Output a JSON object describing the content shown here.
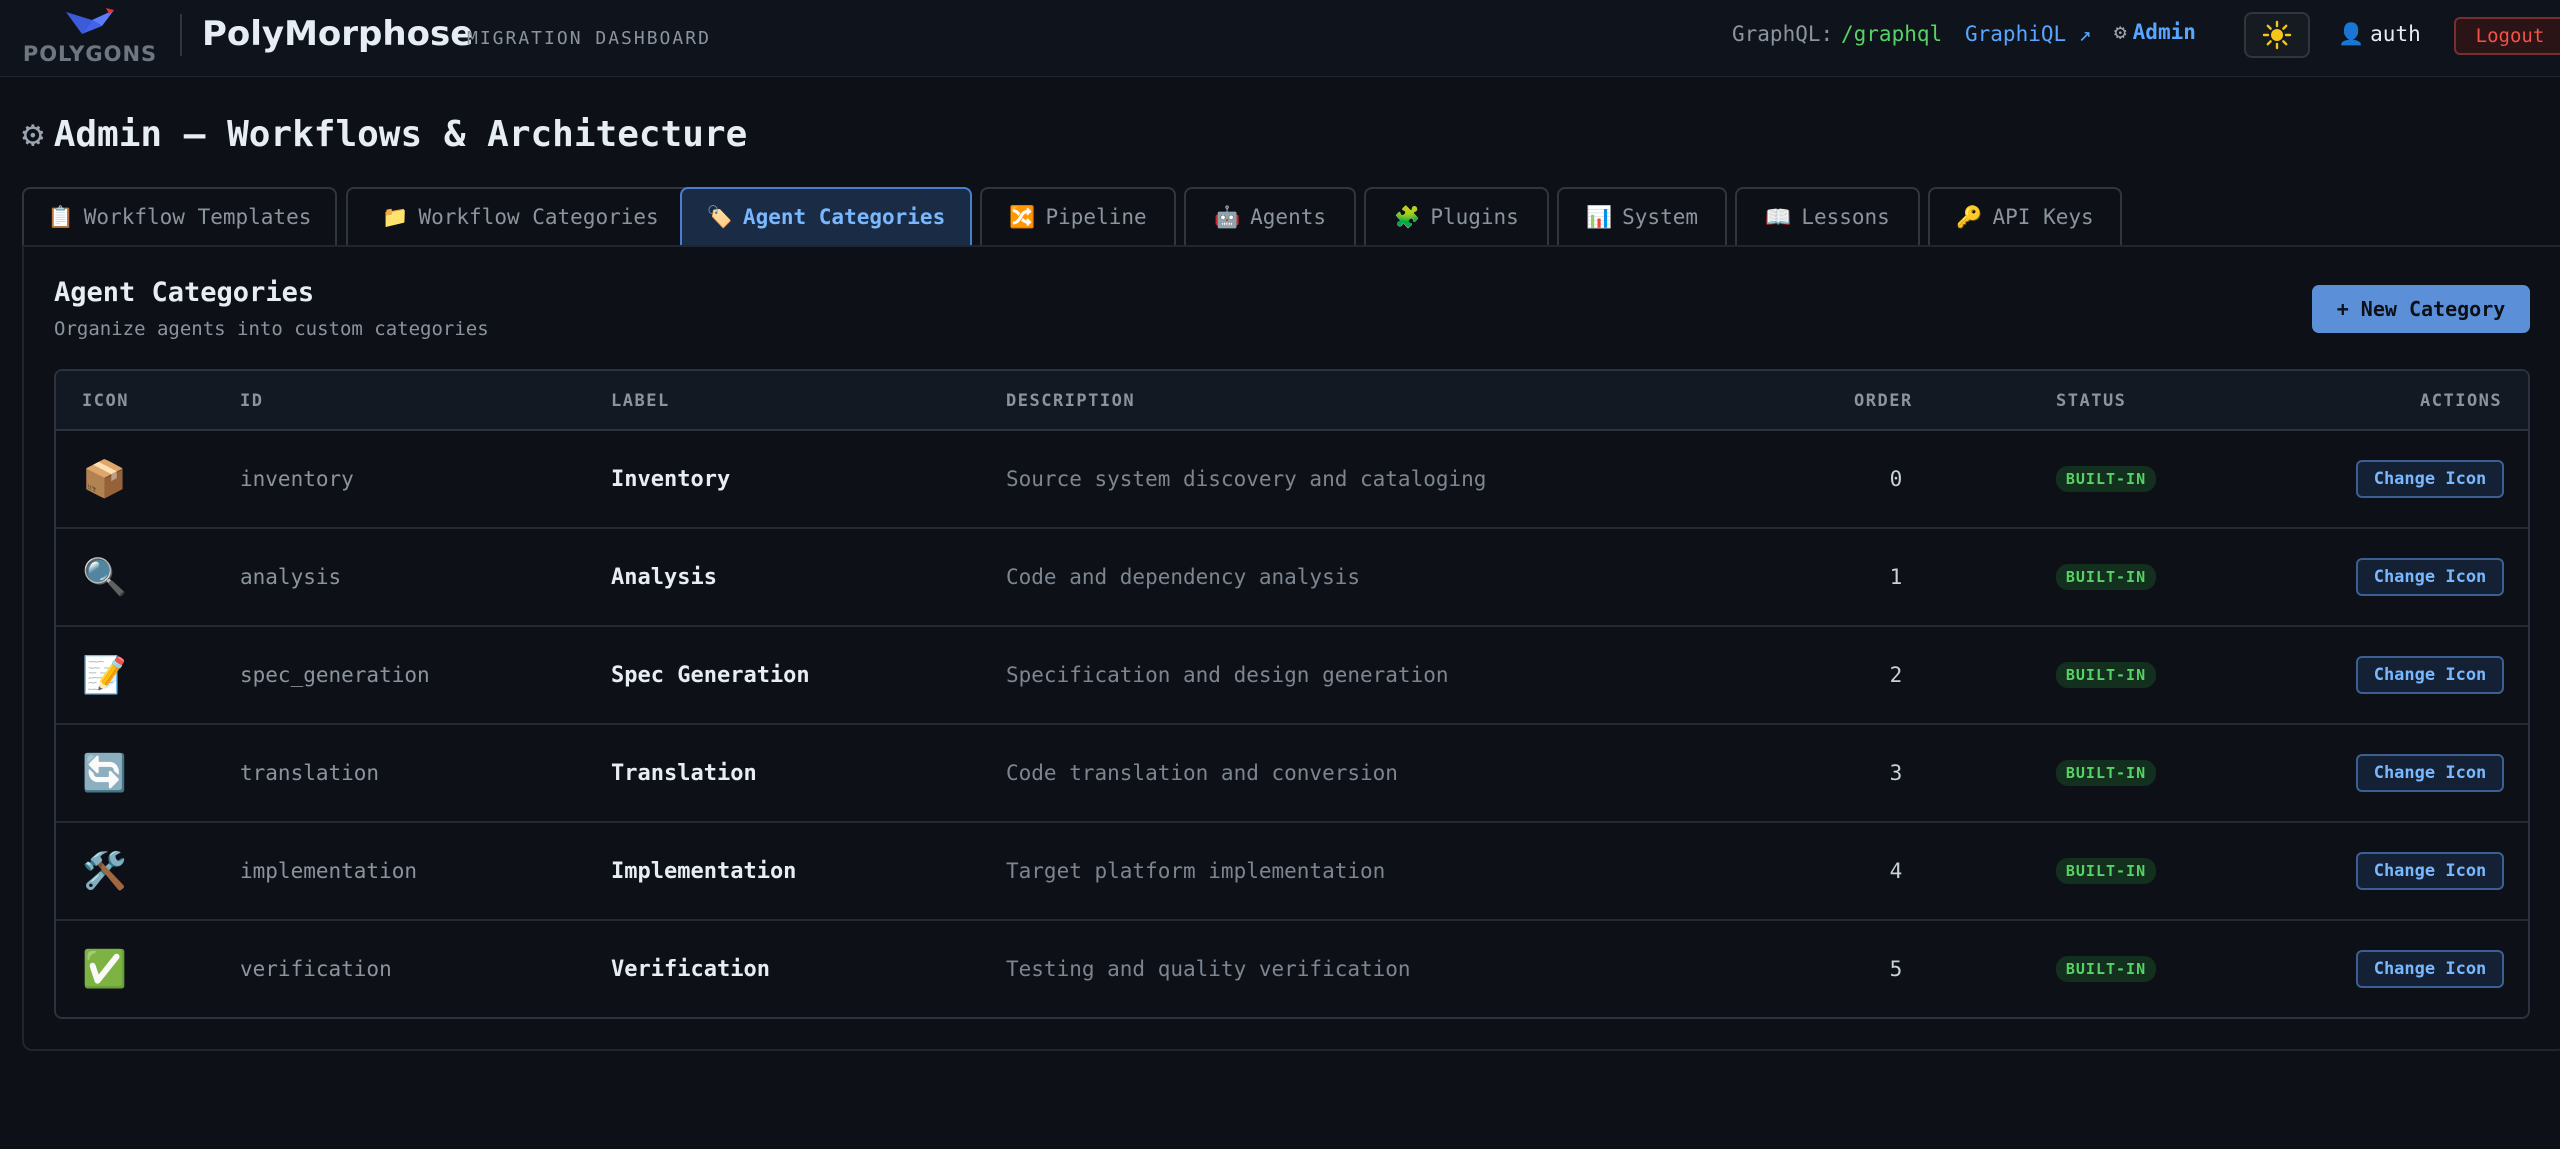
{
  "header": {
    "logo_text": "POLYGONS",
    "app_name": "PolyMorphose",
    "app_subtitle": "MIGRATION DASHBOARD",
    "graphql_label": "GraphQL:",
    "graphql_path": "/graphql",
    "graphiql_link": "GraphiQL ↗",
    "admin_label": "Admin",
    "user_name": "auth",
    "logout_label": "Logout"
  },
  "page": {
    "title": "Admin — Workflows & Architecture"
  },
  "tabs": [
    {
      "icon": "📋",
      "label": "Workflow Templates"
    },
    {
      "icon": "📁",
      "label": "Workflow Categories"
    },
    {
      "icon": "🏷️",
      "label": "Agent Categories"
    },
    {
      "icon": "🔀",
      "label": "Pipeline"
    },
    {
      "icon": "🤖",
      "label": "Agents"
    },
    {
      "icon": "🧩",
      "label": "Plugins"
    },
    {
      "icon": "📊",
      "label": "System"
    },
    {
      "icon": "📖",
      "label": "Lessons"
    },
    {
      "icon": "🔑",
      "label": "API Keys"
    }
  ],
  "section": {
    "title": "Agent Categories",
    "subtitle": "Organize agents into custom categories",
    "new_button": "+ New Category"
  },
  "table": {
    "columns": {
      "icon": "ICON",
      "id": "ID",
      "label": "LABEL",
      "description": "DESCRIPTION",
      "order": "ORDER",
      "status": "STATUS",
      "actions": "ACTIONS"
    },
    "rows": [
      {
        "icon": "📦",
        "id": "inventory",
        "label": "Inventory",
        "description": "Source system discovery and cataloging",
        "order": "0",
        "status": "BUILT-IN",
        "action": "Change Icon"
      },
      {
        "icon": "🔍",
        "id": "analysis",
        "label": "Analysis",
        "description": "Code and dependency analysis",
        "order": "1",
        "status": "BUILT-IN",
        "action": "Change Icon"
      },
      {
        "icon": "📝",
        "id": "spec_generation",
        "label": "Spec Generation",
        "description": "Specification and design generation",
        "order": "2",
        "status": "BUILT-IN",
        "action": "Change Icon"
      },
      {
        "icon": "🔄",
        "id": "translation",
        "label": "Translation",
        "description": "Code translation and conversion",
        "order": "3",
        "status": "BUILT-IN",
        "action": "Change Icon"
      },
      {
        "icon": "🛠️",
        "id": "implementation",
        "label": "Implementation",
        "description": "Target platform implementation",
        "order": "4",
        "status": "BUILT-IN",
        "action": "Change Icon"
      },
      {
        "icon": "✅",
        "id": "verification",
        "label": "Verification",
        "description": "Testing and quality verification",
        "order": "5",
        "status": "BUILT-IN",
        "action": "Change Icon"
      }
    ]
  },
  "colors": {
    "background": "#0d1117",
    "accent": "#58a6ff",
    "active_tab": "#1a2b45",
    "primary_button": "#5b8fd8",
    "badge_green": "#56d364",
    "logout_red": "#f85149"
  }
}
